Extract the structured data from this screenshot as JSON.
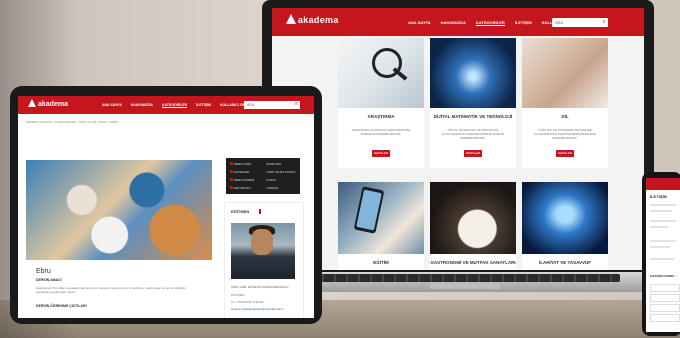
{
  "brand": {
    "name": "akadema",
    "accent": "#c4161c"
  },
  "laptop": {
    "nav": [
      "ANA SAYFA",
      "HAKKIMIZDA",
      "KATEGORİLER",
      "İLETİŞİM",
      "KULLANICI GİRİŞİ"
    ],
    "active_nav_index": 2,
    "search_placeholder": "ARA",
    "cards": [
      {
        "title": "ARAŞTIRMA",
        "desc": "ARAŞTIRMA ALANINDAKİ DERSLERİMİZE BURADAN ERİŞEBİLİRSİNİZ.",
        "button": "DERSLER"
      },
      {
        "title": "DİJİTAL MATEMATİK VE TEKNOLOJİ",
        "desc": "DİJİTAL MATEMATİK VE TEKNOLOJİ ALANLARINDAKİ DERSLERİMİZE BURADAN ERİŞEBİLİRSİNİZ.",
        "button": "DERSLER"
      },
      {
        "title": "DİL",
        "desc": "TÜRK DİLİ VE ÖĞRENME SİSTEMLERİ ALANLARINDAKİ DERSLERİMİZE BURADAN ERİŞEBİLİRSİNİZ.",
        "button": "DERSLER"
      },
      {
        "title": "EĞİTİM"
      },
      {
        "title": "GASTRONOMİ VE MUTFAK SANATLARI"
      },
      {
        "title": "İLAHİYAT VE TASAVVUF"
      }
    ]
  },
  "tablet": {
    "nav": [
      "ANA SAYFA",
      "HAKKIMIZDA",
      "KATEGORİLER",
      "İLETİŞİM",
      "KULLANICI GİRİŞİ"
    ],
    "active_nav_index": 2,
    "search_placeholder": "ARA",
    "breadcrumb": "BİRİMİM AKADEMİ  ›  KATEGORİLER  ›  TÜRK İSLAM SANATI  ›  EBRU",
    "course_title": "Ebru",
    "section_heading": "DERSİN AMACI",
    "section_text": "Geleneksel Türk-İslam sanatlarından olan ebru sanatının genel tanıtımı, tarihçesi, malzemeleri ve temel teknikleri tanıtılarak uygulamalar yapılır.",
    "section_heading_2": "DERSİN ÖĞRENME ÇIKTILARI",
    "info_box": [
      {
        "label": "DERS TÜRÜ",
        "value": "ÜCRETSİZ"
      },
      {
        "label": "KATEGORİ",
        "value": "TÜRK İSLAM SANATI"
      },
      {
        "label": "DERS SÜRESİ",
        "value": "3 SAAT"
      },
      {
        "label": "EĞİTİM DİLİ",
        "value": "TÜRKÇE"
      }
    ],
    "instructor": {
      "heading": "EĞİTMEN",
      "name": "ÖĞR. GÖR. HÜSEYİN KARAKAVAKOĞLU",
      "line1": "EĞİTMEN",
      "line2": "TC. ÜSKÜDAR ÜNİVER...",
      "email": "huseyin.karakavakoglu@uskudar.edu.tr"
    }
  },
  "phone": {
    "title": "İLETİŞİM",
    "form_heading": "İLETİŞİM FORMU ↓"
  }
}
